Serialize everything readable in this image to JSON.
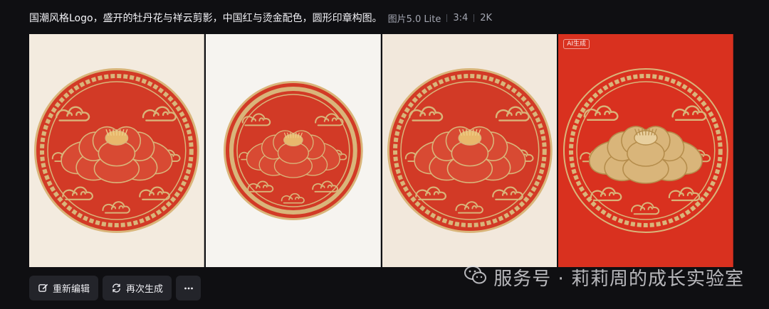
{
  "header": {
    "prompt": "国潮风格Logo，盛开的牡丹花与祥云剪影，中国红与烫金配色，圆形印章构图。",
    "model": "图片5.0 Lite",
    "ratio": "3:4",
    "resolution": "2K"
  },
  "images": [
    {
      "name": "result-1",
      "background": "#f3ebdf",
      "badge": ""
    },
    {
      "name": "result-2",
      "background": "#f6f4f0",
      "badge": ""
    },
    {
      "name": "result-3",
      "background": "#f2e8dc",
      "badge": ""
    },
    {
      "name": "result-4",
      "background": "#d9311f",
      "badge": "AI生成"
    }
  ],
  "toolbar": {
    "edit_label": "重新编辑",
    "edit_icon": "edit-icon",
    "regenerate_label": "再次生成",
    "regenerate_icon": "refresh-icon",
    "more_icon": "more-icon"
  },
  "watermark": {
    "text": "服务号 · 莉莉周的成长实验室",
    "icon": "wechat-icon"
  },
  "colors": {
    "background": "#0f0f12",
    "seal_red": "#d23a26",
    "gold": "#d9b57a"
  }
}
